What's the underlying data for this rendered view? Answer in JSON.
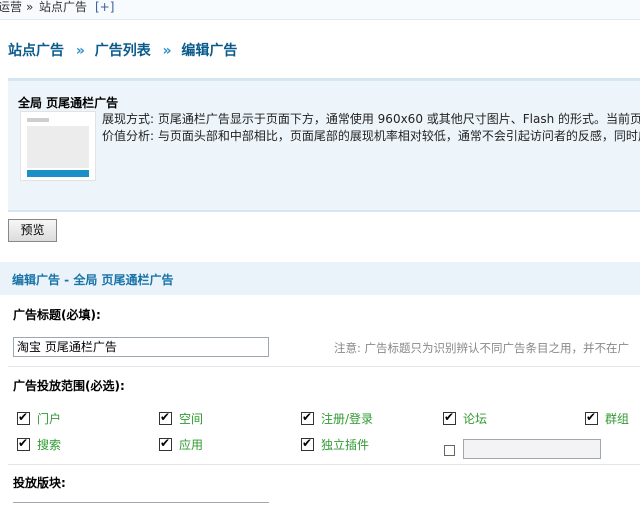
{
  "topbar": {
    "crumb_a": "运营",
    "crumb_sep": "»",
    "crumb_b": "站点广告",
    "add_label": "[+]"
  },
  "heading": {
    "part1": "站点广告",
    "sep1": "»",
    "part2": "广告列表",
    "sep2": "»",
    "part3": "编辑广告"
  },
  "info": {
    "title": "全局  页尾通栏广告",
    "line1": "展现方式: 页尾通栏广告显示于页面下方，通常使用  960x60 或其他尺寸图片、Flash 的形式。当前页",
    "line2": "价值分析: 与页面头部和中部相比，页面尾部的展现机率相对较低，通常不会引起访问者的反感，同时广"
  },
  "preview_button": "预览",
  "section_title": "编辑广告  - 全局  页尾通栏广告",
  "form": {
    "title_label": "广告标题(必填):",
    "title_value": "淘宝   页尾通栏广告",
    "title_note": "注意: 广告标题只为识别辨认不同广告条目之用，并不在广",
    "scope_label": "广告投放范围(必选):",
    "scope_items": [
      {
        "label": "门户",
        "checked": true
      },
      {
        "label": "空间",
        "checked": true
      },
      {
        "label": "注册/登录",
        "checked": true
      },
      {
        "label": "论坛",
        "checked": true
      },
      {
        "label": "群组",
        "checked": true
      },
      {
        "label": "搜索",
        "checked": true
      },
      {
        "label": "应用",
        "checked": true
      },
      {
        "label": "独立插件",
        "checked": true
      }
    ],
    "other_checked": false,
    "other_value": "",
    "block_label": "投放版块:"
  }
}
